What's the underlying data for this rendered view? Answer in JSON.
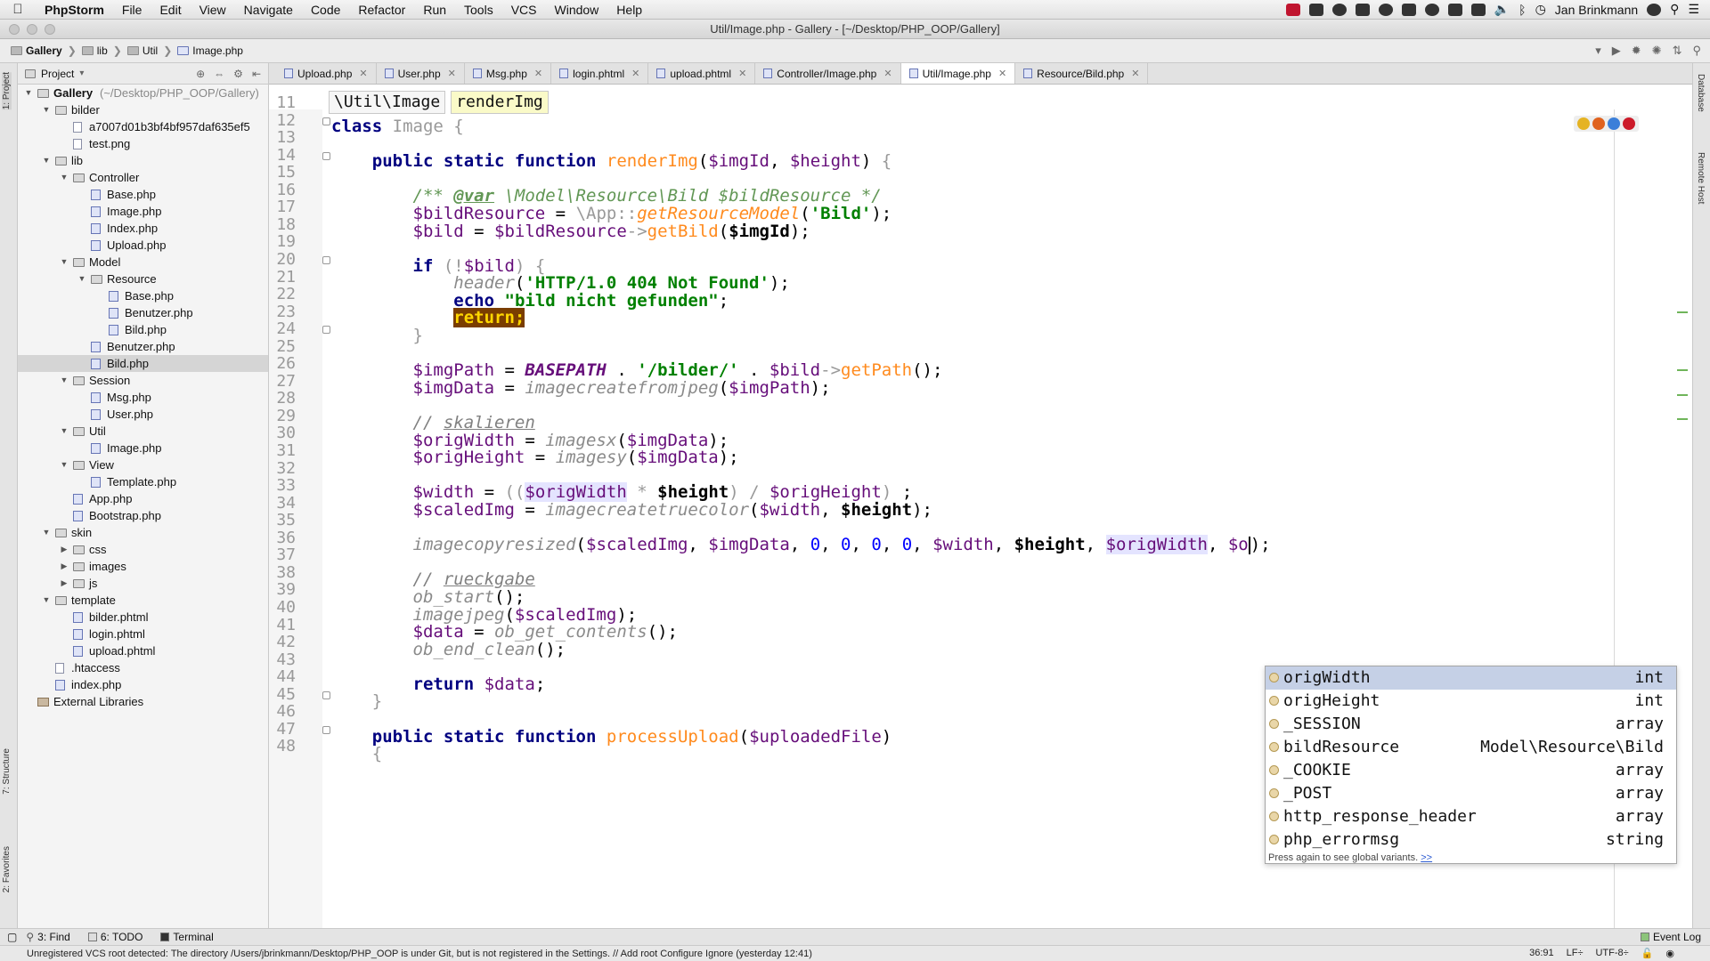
{
  "menubar": {
    "app_name": "PhpStorm",
    "items": [
      "File",
      "Edit",
      "View",
      "Navigate",
      "Code",
      "Refactor",
      "Run",
      "Tools",
      "VCS",
      "Window",
      "Help"
    ],
    "user": "Jan Brinkmann"
  },
  "window": {
    "title": "Util/Image.php - Gallery - [~/Desktop/PHP_OOP/Gallery]"
  },
  "navbar": {
    "crumbs": [
      "Gallery",
      "lib",
      "Util",
      "Image.php"
    ]
  },
  "project_panel": {
    "title": "Project",
    "tree": [
      {
        "label": "Gallery",
        "suffix": "(~/Desktop/PHP_OOP/Gallery)",
        "depth": 0,
        "kind": "folder",
        "expanded": true
      },
      {
        "label": "bilder",
        "depth": 1,
        "kind": "folder",
        "expanded": true
      },
      {
        "label": "a7007d01b3bf4bf957daf635ef5",
        "depth": 2,
        "kind": "file"
      },
      {
        "label": "test.png",
        "depth": 2,
        "kind": "file"
      },
      {
        "label": "lib",
        "depth": 1,
        "kind": "folder",
        "expanded": true
      },
      {
        "label": "Controller",
        "depth": 2,
        "kind": "folder",
        "expanded": true
      },
      {
        "label": "Base.php",
        "depth": 3,
        "kind": "php"
      },
      {
        "label": "Image.php",
        "depth": 3,
        "kind": "php"
      },
      {
        "label": "Index.php",
        "depth": 3,
        "kind": "php"
      },
      {
        "label": "Upload.php",
        "depth": 3,
        "kind": "php"
      },
      {
        "label": "Model",
        "depth": 2,
        "kind": "folder",
        "expanded": true
      },
      {
        "label": "Resource",
        "depth": 3,
        "kind": "folder",
        "expanded": true
      },
      {
        "label": "Base.php",
        "depth": 4,
        "kind": "php"
      },
      {
        "label": "Benutzer.php",
        "depth": 4,
        "kind": "php"
      },
      {
        "label": "Bild.php",
        "depth": 4,
        "kind": "php"
      },
      {
        "label": "Benutzer.php",
        "depth": 3,
        "kind": "php"
      },
      {
        "label": "Bild.php",
        "depth": 3,
        "kind": "php",
        "selected": true
      },
      {
        "label": "Session",
        "depth": 2,
        "kind": "folder",
        "expanded": true
      },
      {
        "label": "Msg.php",
        "depth": 3,
        "kind": "php"
      },
      {
        "label": "User.php",
        "depth": 3,
        "kind": "php"
      },
      {
        "label": "Util",
        "depth": 2,
        "kind": "folder",
        "expanded": true
      },
      {
        "label": "Image.php",
        "depth": 3,
        "kind": "php"
      },
      {
        "label": "View",
        "depth": 2,
        "kind": "folder",
        "expanded": true
      },
      {
        "label": "Template.php",
        "depth": 3,
        "kind": "php"
      },
      {
        "label": "App.php",
        "depth": 2,
        "kind": "php"
      },
      {
        "label": "Bootstrap.php",
        "depth": 2,
        "kind": "php"
      },
      {
        "label": "skin",
        "depth": 1,
        "kind": "folder",
        "expanded": true
      },
      {
        "label": "css",
        "depth": 2,
        "kind": "folder",
        "expanded": false
      },
      {
        "label": "images",
        "depth": 2,
        "kind": "folder",
        "expanded": false
      },
      {
        "label": "js",
        "depth": 2,
        "kind": "folder",
        "expanded": false
      },
      {
        "label": "template",
        "depth": 1,
        "kind": "folder",
        "expanded": true
      },
      {
        "label": "bilder.phtml",
        "depth": 2,
        "kind": "php"
      },
      {
        "label": "login.phtml",
        "depth": 2,
        "kind": "php"
      },
      {
        "label": "upload.phtml",
        "depth": 2,
        "kind": "php"
      },
      {
        "label": ".htaccess",
        "depth": 1,
        "kind": "file"
      },
      {
        "label": "index.php",
        "depth": 1,
        "kind": "php"
      },
      {
        "label": "External Libraries",
        "depth": 0,
        "kind": "lib"
      }
    ]
  },
  "tabs": [
    {
      "label": "Upload.php",
      "active": false
    },
    {
      "label": "User.php",
      "active": false
    },
    {
      "label": "Msg.php",
      "active": false
    },
    {
      "label": "login.phtml",
      "active": false
    },
    {
      "label": "upload.phtml",
      "active": false
    },
    {
      "label": "Controller/Image.php",
      "active": false
    },
    {
      "label": "Util/Image.php",
      "active": true
    },
    {
      "label": "Resource/Bild.php",
      "active": false
    }
  ],
  "editor": {
    "breadcrumb": [
      "\\Util\\Image",
      "renderImg"
    ],
    "first_line": 11,
    "line_count": 38,
    "cursor": "36:91"
  },
  "autocomplete": {
    "items": [
      {
        "name": "origWidth",
        "type": "int",
        "selected": true
      },
      {
        "name": "origHeight",
        "type": "int"
      },
      {
        "name": "_SESSION",
        "type": "array"
      },
      {
        "name": "bildResource",
        "type": "Model\\Resource\\Bild"
      },
      {
        "name": "_COOKIE",
        "type": "array"
      },
      {
        "name": "_POST",
        "type": "array"
      },
      {
        "name": "http_response_header",
        "type": "array"
      },
      {
        "name": "php_errormsg",
        "type": "string"
      }
    ],
    "footer": "Press again to see global variants.",
    "footer_link": ">>"
  },
  "stripes": {
    "left": [
      "1: Project",
      "7: Structure",
      "2: Favorites"
    ],
    "right": [
      "Database",
      "Remote Host"
    ]
  },
  "toolwindows": {
    "find": "3: Find",
    "todo": "6: TODO",
    "terminal": "Terminal",
    "event_log": "Event Log"
  },
  "status": {
    "message": "Unregistered VCS root detected: The directory /Users/jbrinkmann/Desktop/PHP_OOP is under Git, but is not registered in the Settings. // Add root  Configure  Ignore (yesterday 12:41)",
    "position": "36:91",
    "line_sep": "LF÷",
    "encoding": "UTF-8÷"
  }
}
